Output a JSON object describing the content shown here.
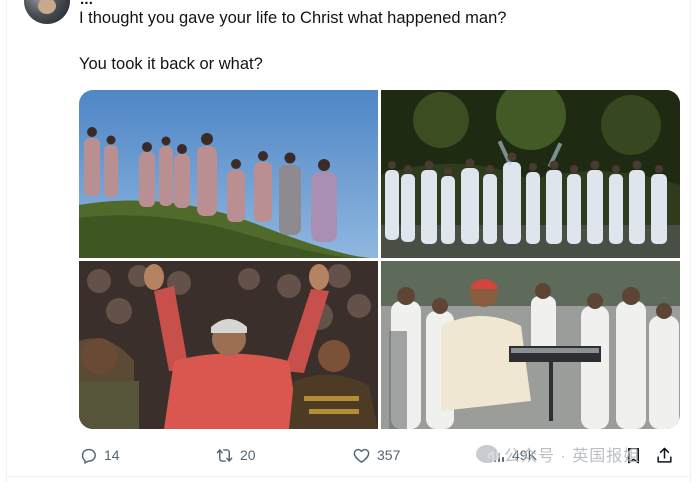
{
  "header": {
    "partial_name": "..."
  },
  "tweet": {
    "lines": [
      "I thought you gave your life to Christ what happened man?",
      "You took it back or what?"
    ]
  },
  "media": [
    {
      "icon": "photo-choir-hillside"
    },
    {
      "icon": "photo-choir-white-outdoor"
    },
    {
      "icon": "photo-crowd-hands-raised"
    },
    {
      "icon": "photo-performer-keyboard"
    }
  ],
  "actions": {
    "reply_count": "14",
    "retweet_count": "20",
    "like_count": "357",
    "views_count": "49K"
  },
  "watermark": {
    "text": "公众号 · 英国报姐"
  },
  "colors": {
    "text": "#0f1419",
    "muted": "#536471",
    "border": "#eff3f4"
  }
}
